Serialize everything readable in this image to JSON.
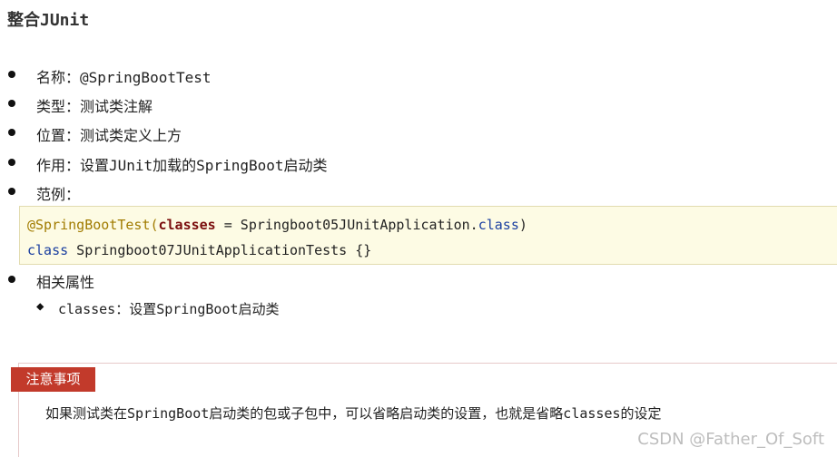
{
  "title": "整合JUnit",
  "list": {
    "items": [
      {
        "text": "名称：@SpringBootTest"
      },
      {
        "text": "类型：测试类注解"
      },
      {
        "text": "位置：测试类定义上方"
      },
      {
        "text": "作用：设置JUnit加载的SpringBoot启动类"
      },
      {
        "text": "范例："
      }
    ],
    "related": {
      "label": "相关属性"
    }
  },
  "code": {
    "line1": {
      "annotation": "@SpringBootTest",
      "open_paren": "(",
      "param": "classes",
      "assign": " = Springboot05JUnitApplication.",
      "keyword": "class",
      "close_paren": ")"
    },
    "line2": {
      "keyword": "class",
      "rest": " Springboot07JUnitApplicationTests {}"
    }
  },
  "attributes": [
    {
      "text": "classes：设置SpringBoot启动类"
    }
  ],
  "note": {
    "tag": "注意事项",
    "text": "如果测试类在SpringBoot启动类的包或子包中，可以省略启动类的设置，也就是省略classes的设定"
  },
  "watermark": "CSDN @Father_Of_Soft",
  "colors": {
    "code_background": "#fdfbe4",
    "note_tag_background": "#c23a2b",
    "annotation": "#a17b00",
    "keyword": "#1a3fa0"
  }
}
